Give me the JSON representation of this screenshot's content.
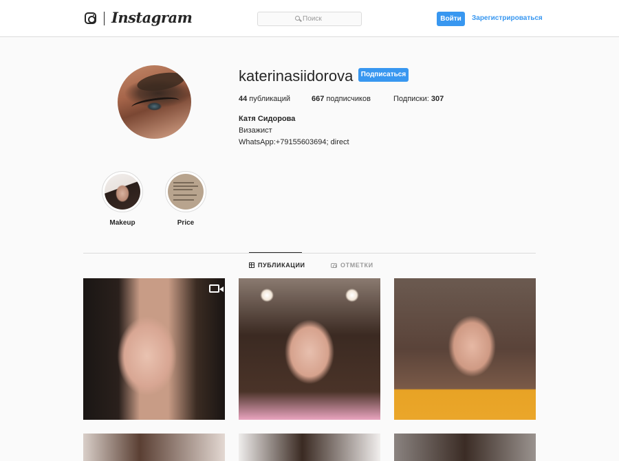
{
  "header": {
    "brand": "Instagram",
    "search_placeholder": "Поиск",
    "login_label": "Войти",
    "signup_label": "Зарегистрироваться"
  },
  "profile": {
    "username": "katerinasiidorova",
    "follow_label": "Подписаться",
    "posts_count": "44",
    "posts_label": " публикаций",
    "followers_count": "667",
    "followers_label": " подписчиков",
    "following_label": "Подписки: ",
    "following_count": "307",
    "full_name": "Катя Сидорова",
    "bio_line1": "Визажист",
    "bio_line2": "WhatsApp:+79155603694; direct"
  },
  "highlights": [
    {
      "label": "Makeup"
    },
    {
      "label": "Price"
    }
  ],
  "tabs": [
    {
      "label": "ПУБЛИКАЦИИ",
      "active": true
    },
    {
      "label": "ОТМЕТКИ",
      "active": false
    }
  ],
  "colors": {
    "accent": "#3897f0",
    "text": "#262626",
    "muted": "#999999",
    "border": "#dbdbdb",
    "background": "#fafafa"
  },
  "icons": [
    "instagram-camera-icon",
    "search-icon",
    "grid-icon",
    "tag-icon",
    "video-icon"
  ]
}
